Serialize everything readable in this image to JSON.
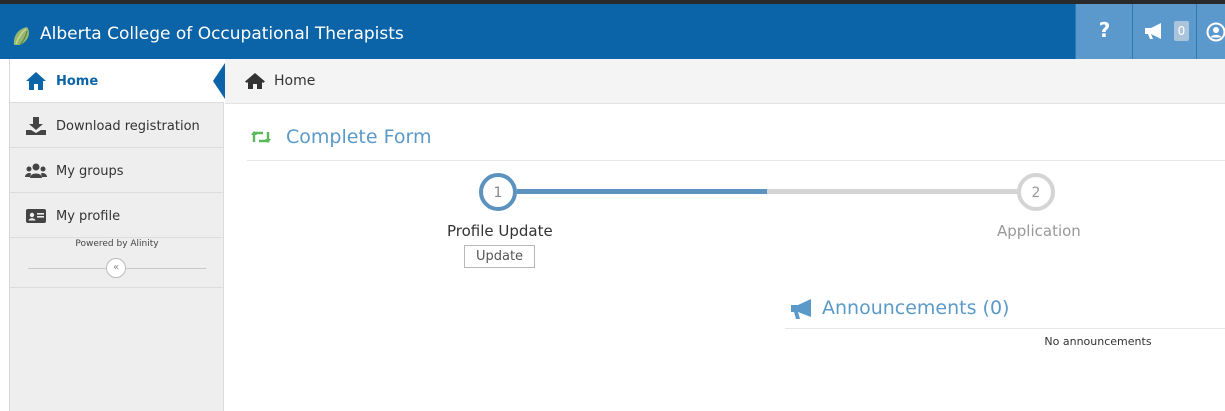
{
  "app": {
    "title": "Alberta College of Occupational Therapists"
  },
  "header": {
    "help_label": "?",
    "announcements_count": "0"
  },
  "sidebar": {
    "items": [
      {
        "label": "Home",
        "icon": "home-icon",
        "active": true
      },
      {
        "label": "Download registration",
        "icon": "download-icon",
        "active": false
      },
      {
        "label": "My groups",
        "icon": "users-icon",
        "active": false
      },
      {
        "label": "My profile",
        "icon": "id-card-icon",
        "active": false
      }
    ],
    "powered_by": "Powered by Alinity",
    "collapse_label": "«"
  },
  "breadcrumb": {
    "label": "Home"
  },
  "form": {
    "title": "Complete Form",
    "steps": [
      {
        "number": "1",
        "label": "Profile Update",
        "status": "current"
      },
      {
        "number": "2",
        "label": "Application",
        "status": "pending"
      }
    ],
    "update_label": "Update"
  },
  "announcements": {
    "title": "Announcements (0)",
    "empty_text": "No announcements"
  },
  "colors": {
    "brand": "#0b63a8",
    "accent": "#5b9ac8",
    "header_button": "#5b98cc",
    "form_icon": "#5cb85c"
  }
}
